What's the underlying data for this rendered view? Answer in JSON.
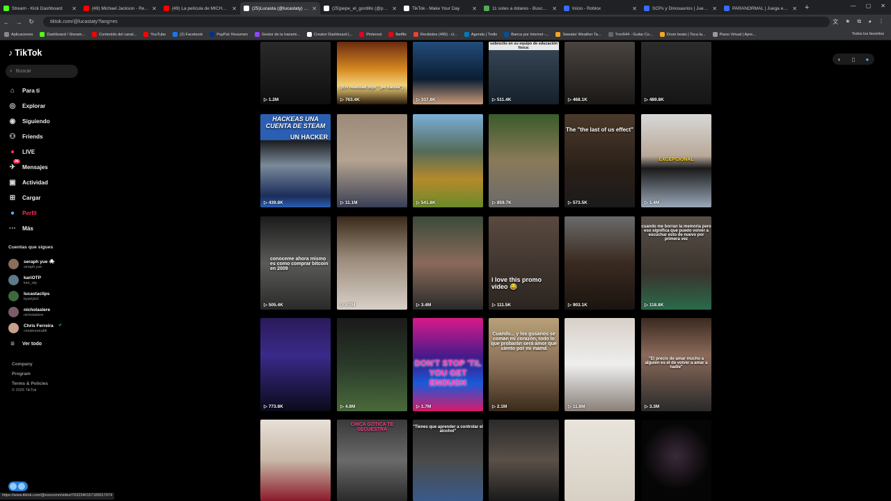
{
  "browser": {
    "tabs": [
      {
        "title": "Stream - Kick Dashboard",
        "color": "#53fc18"
      },
      {
        "title": "(49) Michael Jackson - Remem",
        "color": "#ff0000"
      },
      {
        "title": "(49) La película de MICHAEL...",
        "color": "#ff0000"
      },
      {
        "title": "(25)Lucasta (@lucastaty) | TikT",
        "color": "#ffffff",
        "active": true
      },
      {
        "title": "(25)pepe_el_gordillo (@pepe",
        "color": "#ffffff"
      },
      {
        "title": "TikTok - Make Your Day",
        "color": "#ffffff"
      },
      {
        "title": "11 soles a dolares - Buscar co",
        "color": "#4caf50"
      },
      {
        "title": "Inicio - Roblox",
        "color": "#3a6cf5"
      },
      {
        "title": "SCPs y Dinosaurios | Juega en",
        "color": "#3a6cf5"
      },
      {
        "title": "PARANORMAL | Juega en Rob",
        "color": "#3a6cf5"
      }
    ],
    "url": "tiktok.com/@lucastaty?lang=es",
    "bookmarks": [
      {
        "label": "Aplicaciones",
        "color": "#888888"
      },
      {
        "label": "Dashboard / Stream...",
        "color": "#53fc18"
      },
      {
        "label": "Contenido del canal...",
        "color": "#ff0000"
      },
      {
        "label": "YouTube",
        "color": "#ff0000"
      },
      {
        "label": "(2) Facebook",
        "color": "#1877f2"
      },
      {
        "label": "PayPal: Resumen",
        "color": "#003087"
      },
      {
        "label": "Gestor de la transmi...",
        "color": "#9146ff"
      },
      {
        "label": "Creator Dashboard |...",
        "color": "#ffffff"
      },
      {
        "label": "Pinterest",
        "color": "#e60023"
      },
      {
        "label": "Netflix",
        "color": "#e50914"
      },
      {
        "label": "Recibidos (495) - cl...",
        "color": "#ea4335"
      },
      {
        "label": "Agenda | Trello",
        "color": "#0079bf"
      },
      {
        "label": "Banca por Internet -...",
        "color": "#0050a0"
      },
      {
        "label": "Sweater Weather Ta...",
        "color": "#f5a623"
      },
      {
        "label": "Tron544 - Guitar Co...",
        "color": "#666666"
      },
      {
        "label": "Drum beats | Toca la...",
        "color": "#f5a623"
      },
      {
        "label": "Piano Virtual | Apre...",
        "color": "#999999"
      }
    ],
    "bookmarks_all": "Todos los favoritos",
    "status_url": "https://www.tiktok.com/@evocomn/video/7632340157189917974"
  },
  "sidebar": {
    "logo": "TikTok",
    "search_placeholder": "Buscar",
    "nav": [
      {
        "label": "Para ti",
        "icon": "home-icon",
        "glyph": "⌂"
      },
      {
        "label": "Explorar",
        "icon": "compass-icon",
        "glyph": "◎"
      },
      {
        "label": "Siguiendo",
        "icon": "following-icon",
        "glyph": "◉"
      },
      {
        "label": "Friends",
        "icon": "friends-icon",
        "glyph": "⚇"
      },
      {
        "label": "LIVE",
        "icon": "live-icon",
        "glyph": "●"
      },
      {
        "label": "Mensajes",
        "icon": "messages-icon",
        "glyph": "✈",
        "badge": "36"
      },
      {
        "label": "Actividad",
        "icon": "activity-icon",
        "glyph": "▣"
      },
      {
        "label": "Cargar",
        "icon": "upload-icon",
        "glyph": "⊞"
      },
      {
        "label": "Perfil",
        "icon": "profile-icon",
        "glyph": "●",
        "active": true
      },
      {
        "label": "Más",
        "icon": "more-icon",
        "glyph": "···"
      }
    ],
    "following_header": "Cuentas que sigues",
    "following": [
      {
        "name": "seraph yue 🕷",
        "user": "seraph.yue",
        "color": "#8a6d5c"
      },
      {
        "name": "kariOTP",
        "user": "kari_otp",
        "color": "#5c7a8a"
      },
      {
        "name": "lucastaclips",
        "user": "byselylo1",
        "color": "#3c6a3c"
      },
      {
        "name": "nicholaslere",
        "user": "nicholaslere",
        "color": "#7a5c6a"
      },
      {
        "name": "Chris Ferreira",
        "user": "chrisferreirafifi",
        "color": "#c7a08a",
        "verified": true
      }
    ],
    "see_all": "Ver todo",
    "footer": [
      "Company",
      "Program",
      "Terms & Policies"
    ],
    "copyright": "© 2026 TikTok"
  },
  "grid": {
    "rows": [
      [
        {
          "views": "1.2M",
          "bg": "linear-gradient(180deg,#2a2a2a,#0e0e0e)",
          "caption": "",
          "partial": true
        },
        {
          "views": "763.4K",
          "bg": "linear-gradient(180deg,#6b2a10,#d88b22 45%,#f2d27a 70%,#2a1a0a)",
          "caption": "(En realidad dijo \" pe causa\")"
        },
        {
          "views": "337.8K",
          "bg": "linear-gradient(180deg,#234c7a,#0b1d33 60%,#c99a78)",
          "caption": ""
        },
        {
          "views": "511.4K",
          "bg": "linear-gradient(180deg,#3a4a5a,#15202a)",
          "caption": "sobrecito en su equipo de educación física:"
        },
        {
          "views": "468.1K",
          "bg": "linear-gradient(180deg,#4a4440,#1a1816)",
          "caption": ""
        },
        {
          "views": "489.8K",
          "bg": "linear-gradient(180deg,#2c2c2c,#151515)",
          "caption": ""
        }
      ],
      [
        {
          "views": "439.8K",
          "bg": "linear-gradient(180deg,#2a5fb4 0 28%,#1b1b1b 28%,#7a8a9a 55%,#1b2d5a 88%,#2a5fb4)",
          "caption": "HACKEAS UNA CUENTA DE STEAM",
          "sub": "UN HACKER"
        },
        {
          "views": "11.1M",
          "bg": "linear-gradient(180deg,#9b8a78,#b5a390 50%,#3a3f55)",
          "caption": ""
        },
        {
          "views": "541.8K",
          "bg": "linear-gradient(180deg,#7ab0d8,#556b5a 40%,#b58a2a 70%,#6a8a2a)",
          "caption": ""
        },
        {
          "views": "859.7K",
          "bg": "linear-gradient(180deg,#3a5a2a,#8a7a5a 50%,#6a6a6a)",
          "caption": ""
        },
        {
          "views": "573.5K",
          "bg": "linear-gradient(180deg,#4a3a2a,#2a1f18 60%,#1a1a1a)",
          "caption": "The \"the last of us effect\""
        },
        {
          "views": "1.4M",
          "bg": "linear-gradient(180deg,#d8d8d8,#b8a898 45%,#1a1a1a 58%,#9aa8b8)",
          "caption": "EXCEPCIONAL"
        }
      ],
      [
        {
          "views": "505.4K",
          "bg": "linear-gradient(180deg,#1b1b1b,#5a5a58 50%,#2a2a2a)",
          "caption": "conoceme ahora mismo es como comprar bitcoin en 2009"
        },
        {
          "views": "4.7M",
          "bg": "linear-gradient(180deg,#3a2a1a,#9a8a7a 45%,#d8d0c8)",
          "caption": ""
        },
        {
          "views": "3.4M",
          "bg": "linear-gradient(180deg,#3a4a3a,#8a6a5a 50%,#2a2a2a)",
          "caption": ""
        },
        {
          "views": "111.5K",
          "bg": "linear-gradient(180deg,#5a4a40,#2a2420)",
          "caption": "i love this promo video 😂"
        },
        {
          "views": "903.1K",
          "bg": "linear-gradient(180deg,#6a6a6a,#3a2a20 50%,#1a1410)",
          "caption": ""
        },
        {
          "views": "118.8K",
          "bg": "linear-gradient(180deg,#5a5048,#3a342e 60%,#2a6a4a)",
          "caption": "cuando me borran la memoria pero eso significa que puedo volver a escuchar esto de nuevo por primera vez"
        }
      ],
      [
        {
          "views": "773.8K",
          "bg": "linear-gradient(180deg,#2a1a5a,#3a2a8a 40%,#0a0a1a)",
          "caption": ""
        },
        {
          "views": "4.8M",
          "bg": "linear-gradient(180deg,#1a1a1a,#2a3a2a 50%,#4a6a3a)",
          "caption": ""
        },
        {
          "views": "1.7M",
          "bg": "linear-gradient(180deg,#d81a8a,#3a1a8a 45%,#1a5ad8 70%,#d81a6a)",
          "caption": "DON'T STOP 'TIL YOU GET ENOUGH"
        },
        {
          "views": "2.1M",
          "bg": "linear-gradient(180deg,#b8a078,#8a7058 50%,#3a2a1a)",
          "caption": "Cuando... y los gusanos se coman mi corazón, todo lo que probarán será amor que siento por mi mamá"
        },
        {
          "views": "11.8M",
          "bg": "linear-gradient(180deg,#d8d0c8,#eeeeee 50%,#8a8078)",
          "caption": ""
        },
        {
          "views": "3.3M",
          "bg": "linear-gradient(180deg,#3a2a20,#8a6a5a 40%,#2a2a2a)",
          "caption": "\"El precio de amar mucho a alguien es el de volver a amar a nadie\""
        }
      ],
      [
        {
          "views": "",
          "bg": "linear-gradient(180deg,#e8e0d8,#c8b8a8 50%,#8a1a2a)",
          "caption": ""
        },
        {
          "views": "",
          "bg": "linear-gradient(180deg,#3a3a3a,#6a6a6a 50%,#2a2a2a)",
          "caption": "CHICA GÓTICA TE SECUESTRA"
        },
        {
          "views": "",
          "bg": "linear-gradient(180deg,#2a2a2a,#4a4a4a 50%,#3a5a8a)",
          "caption": "\"Tienes que aprender a controlar el alcohol\""
        },
        {
          "views": "",
          "bg": "linear-gradient(180deg,#2a2a2a,#5a5048 50%,#1a1a1a)",
          "caption": ""
        },
        {
          "views": "",
          "bg": "linear-gradient(180deg,#e8e4dc,#d8d0c4)",
          "caption": ""
        },
        {
          "views": "",
          "bg": "radial-gradient(circle at 50% 45%,#3a2a3a,#050505 60%)",
          "caption": ""
        }
      ]
    ]
  }
}
